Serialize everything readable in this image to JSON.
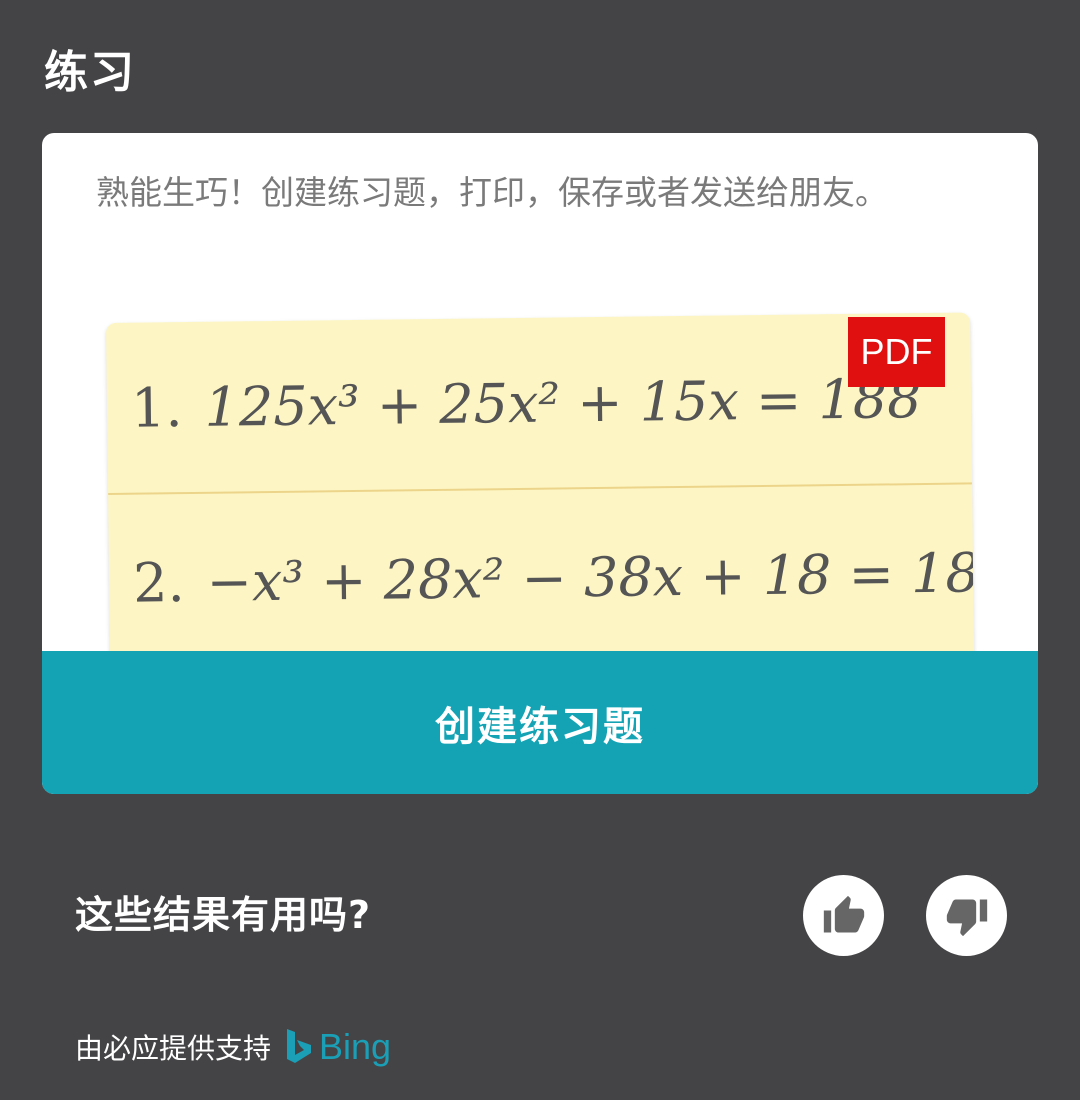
{
  "section": {
    "title": "练习"
  },
  "practice_card": {
    "description": "熟能生巧！创建练习题，打印，保存或者发送给朋友。",
    "pdf_badge": "PDF",
    "problems": [
      {
        "number": "1.",
        "equation": "125x³ + 25x² + 15x = 188"
      },
      {
        "number": "2.",
        "equation": "−x³ + 28x² − 38x + 18 = 18"
      }
    ],
    "create_button_label": "创建练习题"
  },
  "feedback": {
    "question": "这些结果有用吗?"
  },
  "footer": {
    "powered_by": "由必应提供支持",
    "brand": "Bing"
  },
  "colors": {
    "background": "#444446",
    "accent": "#13a3b5",
    "pdf_red": "#e01010",
    "worksheet": "#fdf6c4",
    "bing_teal": "#1a9fb6"
  },
  "icons": {
    "thumbs_up": "thumbs-up-icon",
    "thumbs_down": "thumbs-down-icon",
    "bing_logo": "bing-logo-icon"
  }
}
